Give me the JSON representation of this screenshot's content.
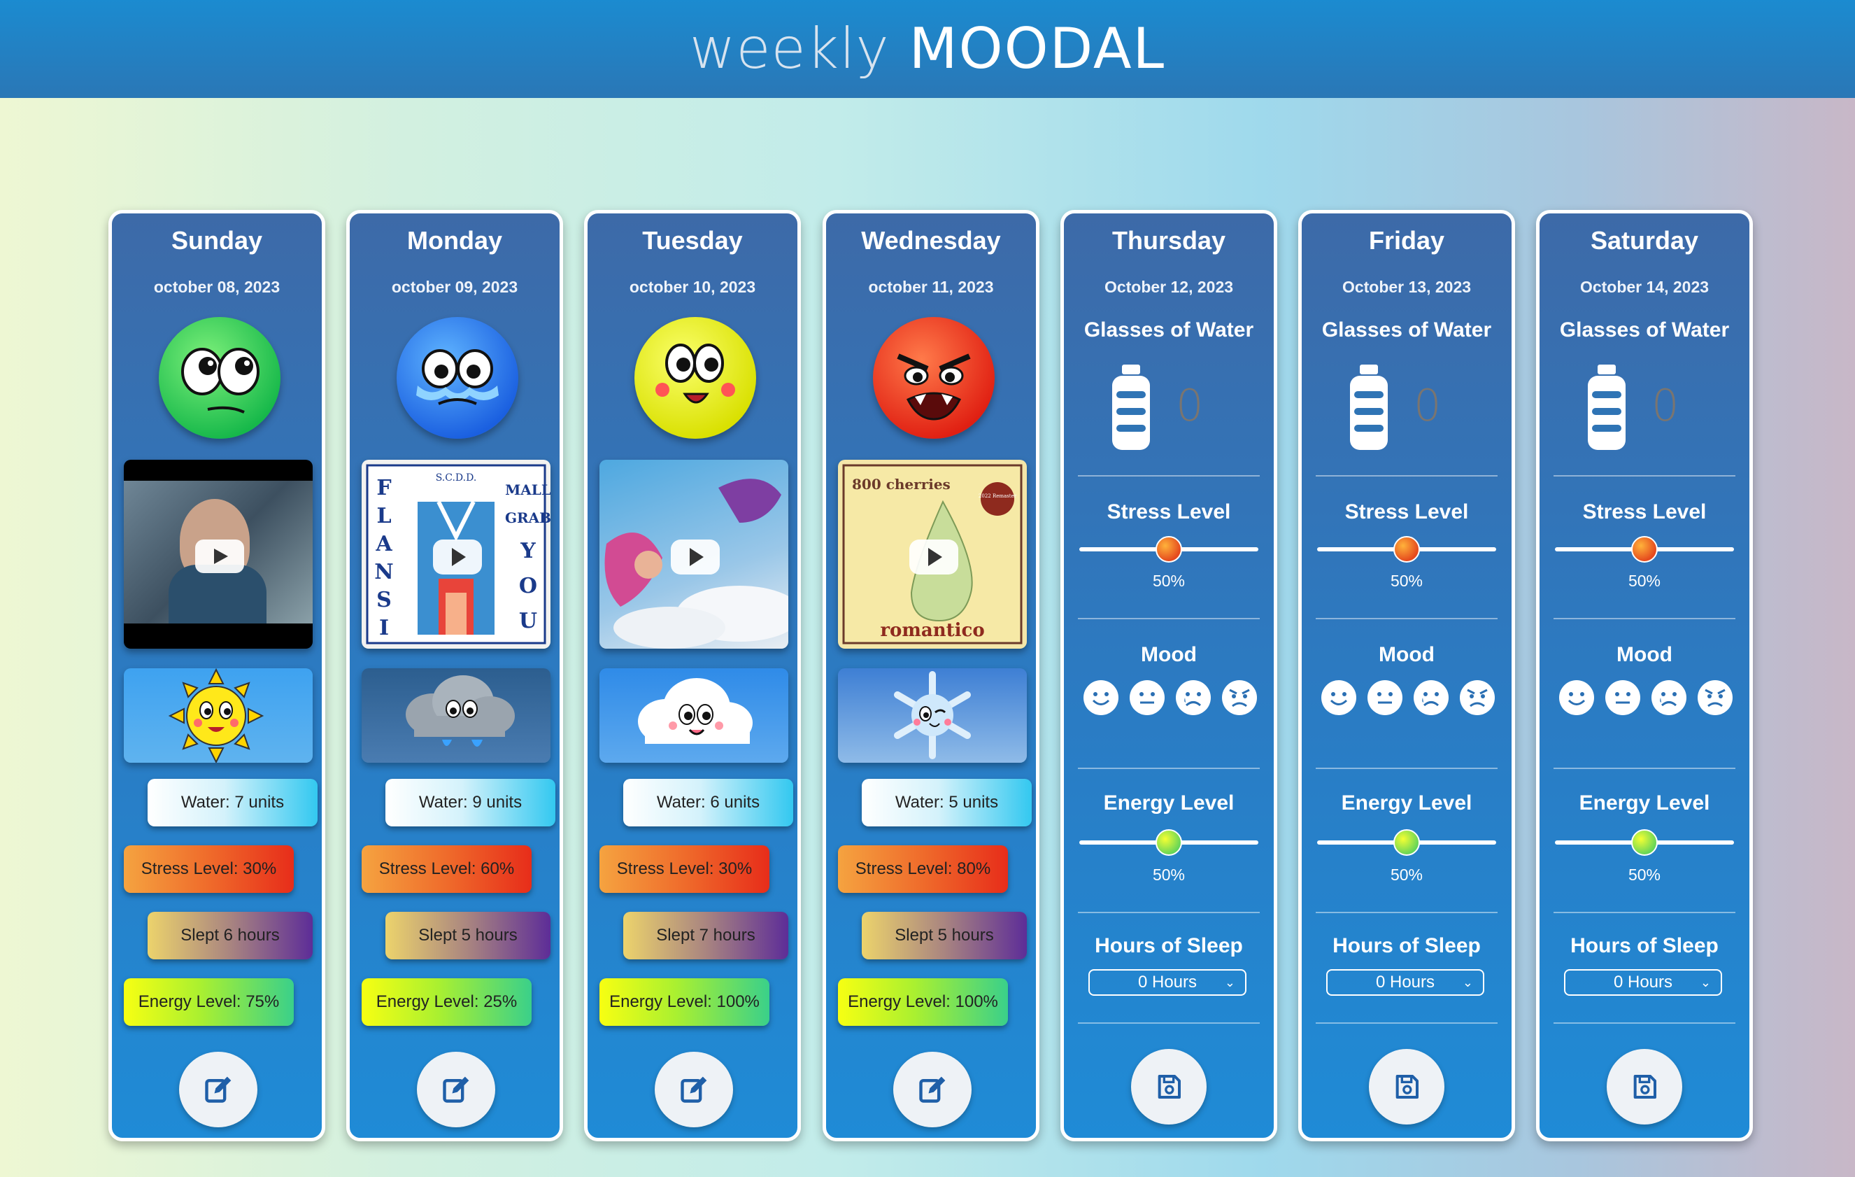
{
  "app": {
    "title_light": "weekly",
    "title_bold": "MOODAL"
  },
  "days": [
    {
      "day": "Sunday",
      "date": "october 08, 2023",
      "water": "Water: 7 units",
      "stress": "Stress Level: 30%",
      "sleep": "Slept 6 hours",
      "energy": "Energy Level: 75%",
      "mood_face": "green-face-icon",
      "weather": "sun-icon"
    },
    {
      "day": "Monday",
      "date": "october 09, 2023",
      "water": "Water: 9 units",
      "stress": "Stress Level: 60%",
      "sleep": "Slept 5 hours",
      "energy": "Energy Level: 25%",
      "mood_face": "blue-crying-face-icon",
      "weather": "rain-cloud-icon"
    },
    {
      "day": "Tuesday",
      "date": "october 10, 2023",
      "water": "Water: 6 units",
      "stress": "Stress Level: 30%",
      "sleep": "Slept 7 hours",
      "energy": "Energy Level: 100%",
      "mood_face": "yellow-happy-face-icon",
      "weather": "cloud-icon"
    },
    {
      "day": "Wednesday",
      "date": "october 11, 2023",
      "water": "Water: 5 units",
      "stress": "Stress Level: 80%",
      "sleep": "Slept 5 hours",
      "energy": "Energy Level: 100%",
      "mood_face": "red-angry-face-icon",
      "weather": "snowflake-icon"
    }
  ],
  "album_text": {
    "wednesday_top": "800 cherries",
    "wednesday_bottom": "romantico",
    "wednesday_badge": "2022 Remaster",
    "monday_left": "FLANSIE",
    "monday_right": "MALL GRAB YOU",
    "monday_top": "S.C.D.D."
  },
  "forms": [
    {
      "day": "Thursday",
      "date": "October 12, 2023",
      "water_label": "Glasses of Water",
      "water_value": "0",
      "stress_label": "Stress Level",
      "stress_pct": "50%",
      "stress_value": 0.5,
      "mood_label": "Mood",
      "energy_label": "Energy Level",
      "energy_pct": "50%",
      "energy_value": 0.5,
      "sleep_label": "Hours of Sleep",
      "sleep_value": "0 Hours"
    },
    {
      "day": "Friday",
      "date": "October 13, 2023",
      "water_label": "Glasses of Water",
      "water_value": "0",
      "stress_label": "Stress Level",
      "stress_pct": "50%",
      "stress_value": 0.5,
      "mood_label": "Mood",
      "energy_label": "Energy Level",
      "energy_pct": "50%",
      "energy_value": 0.5,
      "sleep_label": "Hours of Sleep",
      "sleep_value": "0 Hours"
    },
    {
      "day": "Saturday",
      "date": "October 14, 2023",
      "water_label": "Glasses of Water",
      "water_value": "0",
      "stress_label": "Stress Level",
      "stress_pct": "50%",
      "stress_value": 0.5,
      "mood_label": "Mood",
      "energy_label": "Energy Level",
      "energy_pct": "50%",
      "energy_value": 0.5,
      "sleep_label": "Hours of Sleep",
      "sleep_value": "0 Hours"
    }
  ],
  "icons": {
    "edit": "edit-icon",
    "save": "save-icon",
    "bottle": "water-bottle-icon",
    "play": "play-icon",
    "moods": [
      "smile-icon",
      "neutral-icon",
      "sad-icon",
      "angry-icon"
    ]
  },
  "colors": {
    "topbar": "#1b8bd0",
    "card": "#2a7cc4",
    "water_pill": "#33c8f0",
    "stress_pill": "#e72d1a",
    "sleep_pill": "#5d2d98",
    "energy_pill": "#f7ff12"
  }
}
